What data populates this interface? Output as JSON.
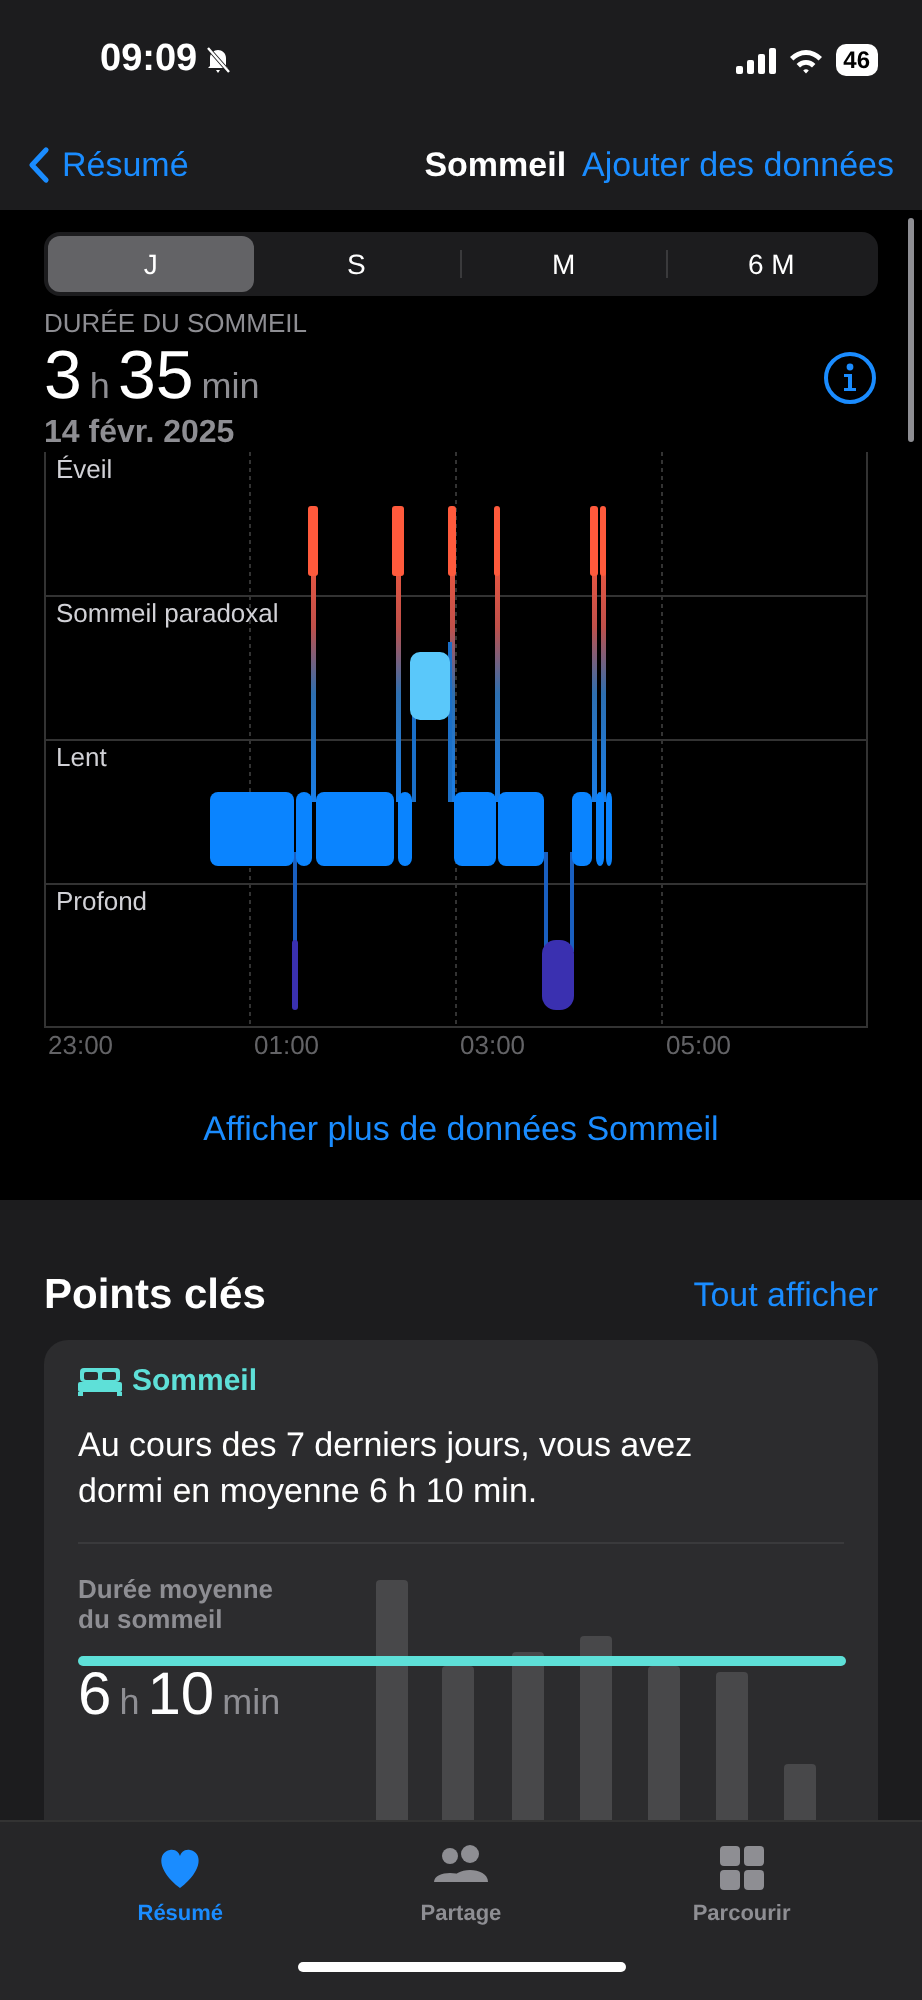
{
  "status_bar": {
    "time": "09:09",
    "battery": "46"
  },
  "nav": {
    "back": "Résumé",
    "title": "Sommeil",
    "action": "Ajouter des données"
  },
  "segments": [
    {
      "label": "J",
      "selected": true
    },
    {
      "label": "S",
      "selected": false
    },
    {
      "label": "M",
      "selected": false
    },
    {
      "label": "6 M",
      "selected": false
    }
  ],
  "summary": {
    "heading": "DURÉE DU SOMMEIL",
    "hours": "3",
    "hours_unit": "h",
    "minutes": "35",
    "minutes_unit": "min",
    "date": "14 févr. 2025"
  },
  "hypnogram": {
    "stages": [
      "Éveil",
      "Sommeil paradoxal",
      "Lent",
      "Profond"
    ],
    "times": [
      "23:00",
      "01:00",
      "03:00",
      "05:00"
    ]
  },
  "more_link": "Afficher plus de données Sommeil",
  "highlights": {
    "title": "Points clés",
    "see_all": "Tout afficher",
    "card": {
      "category": "Sommeil",
      "text": "Au cours des 7 derniers jours, vous avez dormi en moyenne 6 h 10 min.",
      "metric_label": "Durée moyenne du sommeil",
      "hours": "6",
      "hours_unit": "h",
      "minutes": "10",
      "minutes_unit": "min"
    }
  },
  "tab_bar": [
    {
      "label": "Résumé",
      "selected": true
    },
    {
      "label": "Partage",
      "selected": false
    },
    {
      "label": "Parcourir",
      "selected": false
    }
  ]
}
